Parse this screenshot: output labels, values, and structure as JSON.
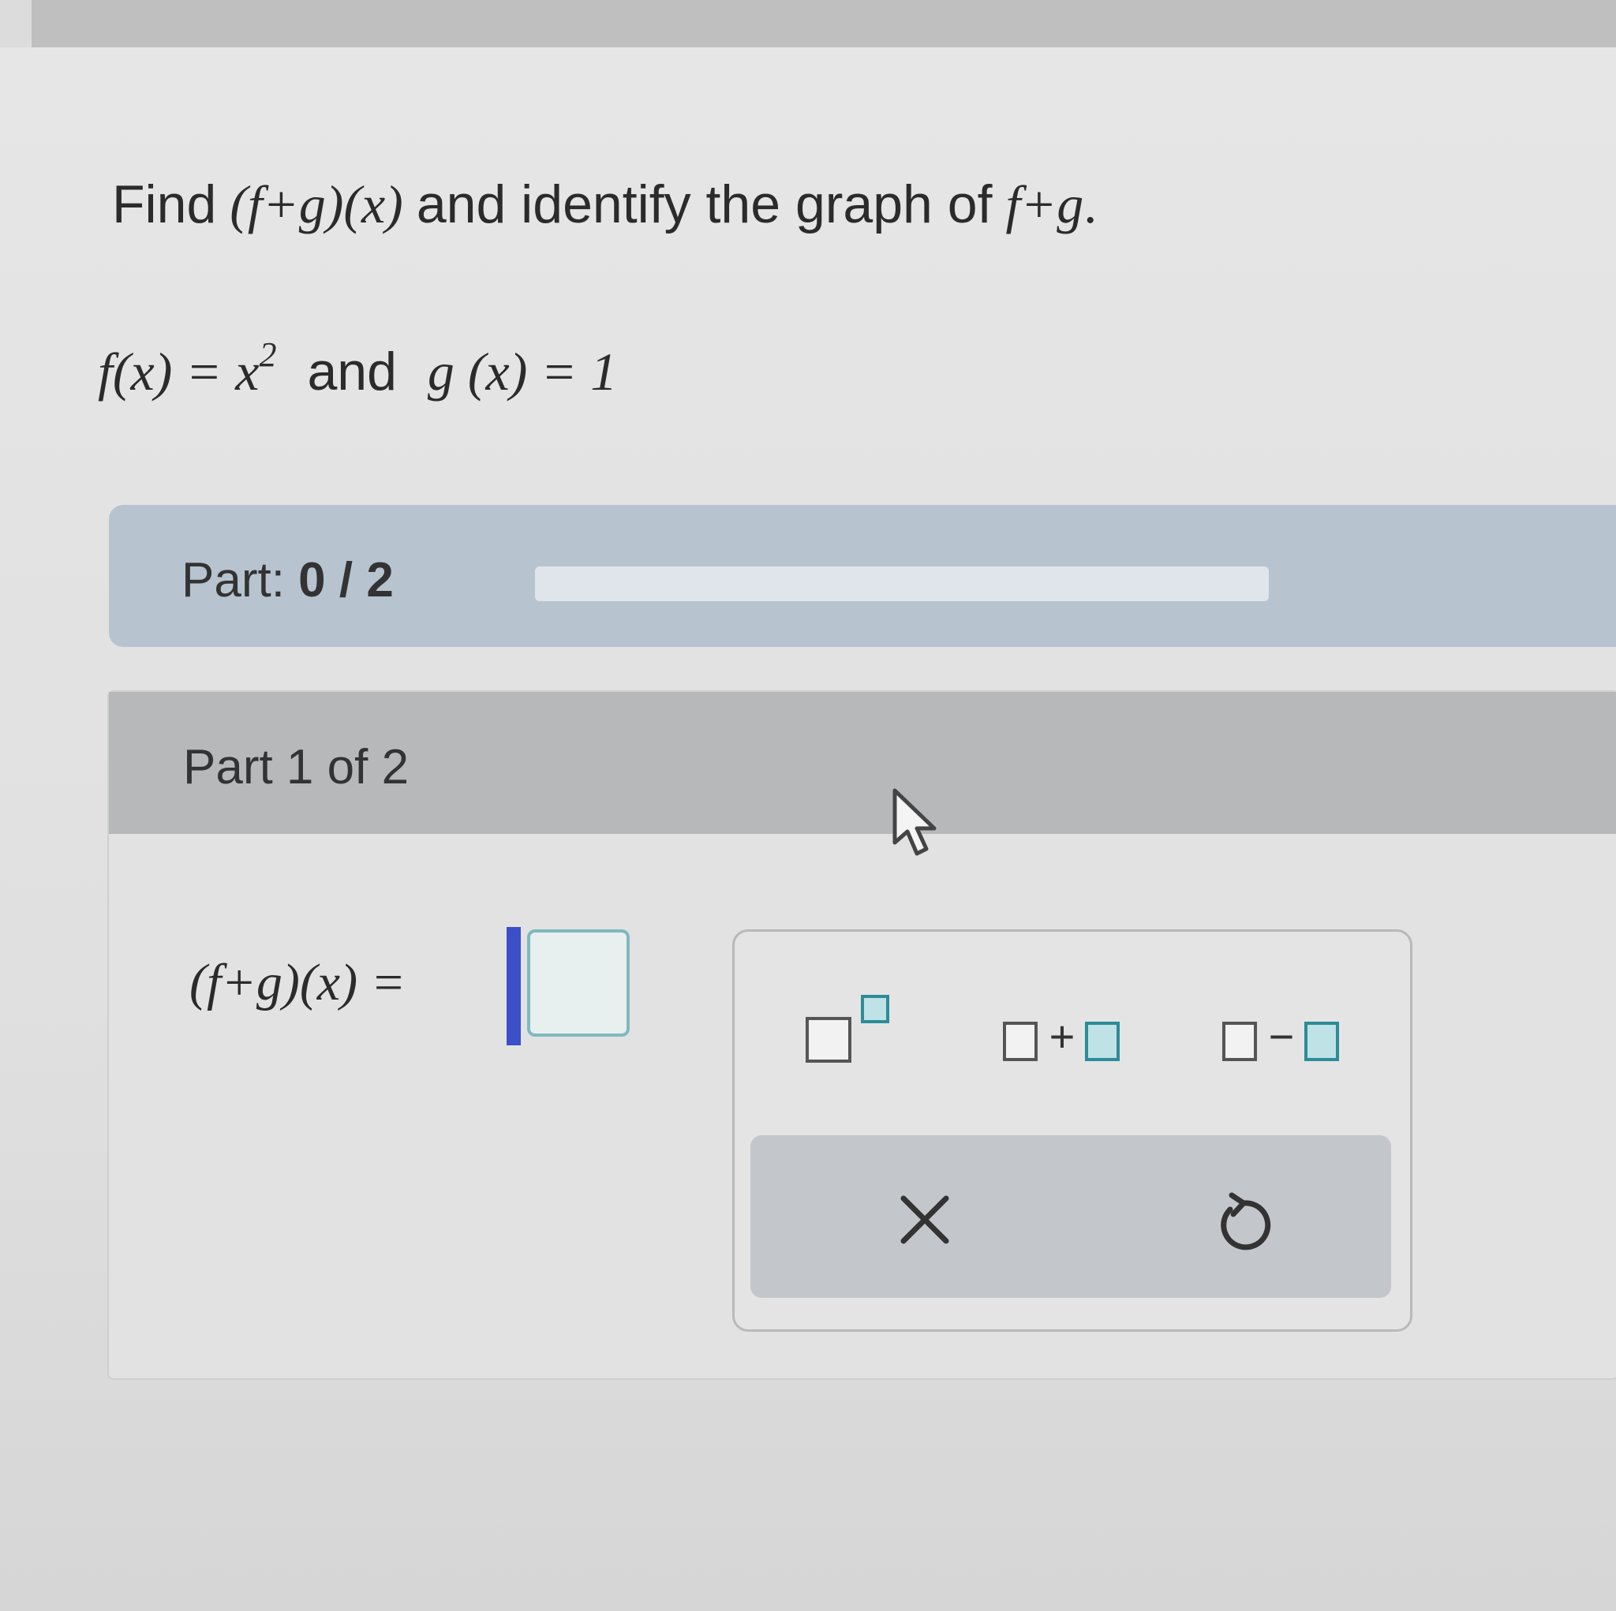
{
  "question": {
    "find": "Find",
    "expr1": "(f+g)(x)",
    "middle": "and identify the graph of",
    "expr2": "f+g",
    "period": "."
  },
  "given": {
    "f_lhs": "f(x) = x",
    "f_exp": "2",
    "conj": "and",
    "g_def": "g (x) = 1"
  },
  "progress": {
    "label": "Part:",
    "value": "0 / 2",
    "completed": 0,
    "total": 2
  },
  "part_header": "Part 1 of 2",
  "answer": {
    "label": "(f+g)(x) =",
    "value": ""
  },
  "keypad": {
    "keys": [
      {
        "name": "superscript",
        "icon": "superscript-template-icon"
      },
      {
        "name": "add",
        "icon": "addition-template-icon",
        "op": "+"
      },
      {
        "name": "subtract",
        "icon": "subtraction-template-icon",
        "op": "−"
      }
    ],
    "actions": [
      {
        "name": "clear",
        "icon": "close-icon"
      },
      {
        "name": "undo",
        "icon": "undo-icon"
      }
    ]
  },
  "colors": {
    "part_bar": "#b7c4cf",
    "card_header": "#b6b8ba",
    "cursor": "#3b4fc9",
    "template_teal": "#2c8c97"
  }
}
